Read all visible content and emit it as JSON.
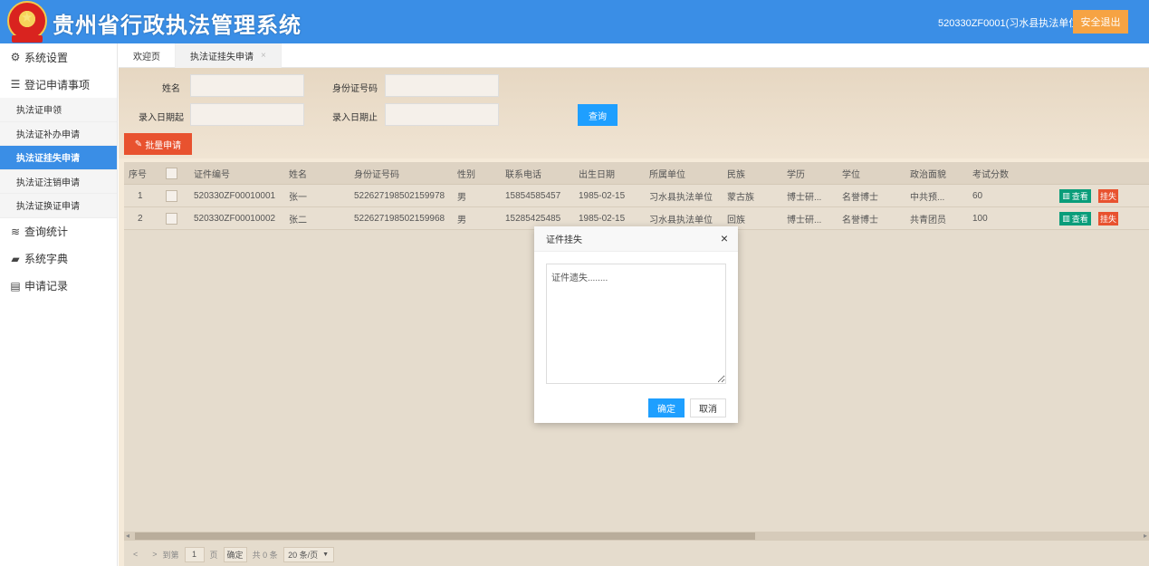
{
  "app": {
    "title": "贵州省行政执法管理系统",
    "user": "520330ZF0001(习水县执法单位)",
    "logout": "安全退出"
  },
  "sidebar": {
    "groups": [
      {
        "label": "系统设置",
        "icon": "gear-icon"
      },
      {
        "label": "登记申请事项",
        "icon": "sliders-icon"
      }
    ],
    "subitems": [
      {
        "label": "执法证申领"
      },
      {
        "label": "执法证补办申请"
      },
      {
        "label": "执法证挂失申请",
        "active": true
      },
      {
        "label": "执法证注销申请"
      },
      {
        "label": "执法证换证申请"
      }
    ],
    "bottom": [
      {
        "label": "查询统计",
        "icon": "database-icon"
      },
      {
        "label": "系统字典",
        "icon": "book-icon"
      },
      {
        "label": "申请记录",
        "icon": "document-icon"
      }
    ]
  },
  "tabs": [
    {
      "label": "欢迎页"
    },
    {
      "label": "执法证挂失申请",
      "active": true,
      "close": "×"
    }
  ],
  "filters": {
    "name_label": "姓名",
    "id_label": "身份证号码",
    "date_from_label": "录入日期起",
    "date_to_label": "录入日期止",
    "query_btn": "查询",
    "batch_btn": "批量申请"
  },
  "table": {
    "headers": [
      "序号",
      "",
      "证件编号",
      "姓名",
      "身份证号码",
      "性别",
      "联系电话",
      "出生日期",
      "所属单位",
      "民族",
      "学历",
      "学位",
      "政治面貌",
      "考试分数"
    ],
    "rows": [
      {
        "no": "1",
        "cert": "520330ZF00010001",
        "name": "张一",
        "id": "522627198502159978",
        "sex": "男",
        "phone": "15854585457",
        "birth": "1985-02-15",
        "unit": "习水县执法单位",
        "ethnic": "蒙古族",
        "edu": "博士研...",
        "degree": "名誉博士",
        "political": "中共预...",
        "score": "60"
      },
      {
        "no": "2",
        "cert": "520330ZF00010002",
        "name": "张二",
        "id": "522627198502159968",
        "sex": "男",
        "phone": "15285425485",
        "birth": "1985-02-15",
        "unit": "习水县执法单位",
        "ethnic": "回族",
        "edu": "博士研...",
        "degree": "名誉博士",
        "political": "共青团员",
        "score": "100"
      }
    ],
    "view_btn": "查看",
    "lost_btn": "挂失"
  },
  "pager": {
    "prev": "<",
    "next": ">",
    "goto": "到第",
    "page": "1",
    "page_unit": "页",
    "confirm": "确定",
    "total": "共 0 条",
    "size": "20 条/页"
  },
  "modal": {
    "title": "证件挂失",
    "close": "×",
    "text": "证件遗失........",
    "confirm": "确定",
    "cancel": "取消"
  }
}
